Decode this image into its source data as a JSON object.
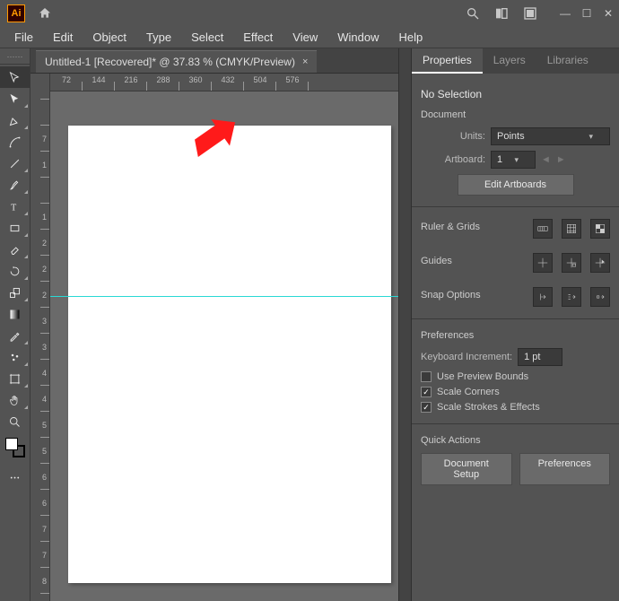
{
  "menu": {
    "file": "File",
    "edit": "Edit",
    "object": "Object",
    "type": "Type",
    "select": "Select",
    "effect": "Effect",
    "view": "View",
    "window": "Window",
    "help": "Help"
  },
  "document_tab": {
    "label": "Untitled-1 [Recovered]* @ 37.83 % (CMYK/Preview)",
    "close": "×"
  },
  "hruler_ticks": [
    "72",
    "144",
    "216",
    "288",
    "360",
    "432",
    "504",
    "576"
  ],
  "vruler_ticks": [
    "",
    "",
    "7",
    "1",
    "",
    "1",
    "2",
    "2",
    "2",
    "3",
    "3",
    "4",
    "4",
    "5",
    "5",
    "6",
    "6",
    "7",
    "7",
    "8"
  ],
  "panel": {
    "tabs": {
      "properties": "Properties",
      "layers": "Layers",
      "libraries": "Libraries"
    },
    "no_selection": "No Selection",
    "document": "Document",
    "units_label": "Units:",
    "units_value": "Points",
    "artboard_label": "Artboard:",
    "artboard_value": "1",
    "edit_artboards": "Edit Artboards",
    "ruler_grids": "Ruler & Grids",
    "guides": "Guides",
    "snap_options": "Snap Options",
    "preferences": "Preferences",
    "keyboard_increment_label": "Keyboard Increment:",
    "keyboard_increment_value": "1 pt",
    "use_preview_bounds": "Use Preview Bounds",
    "scale_corners": "Scale Corners",
    "scale_strokes": "Scale Strokes & Effects",
    "quick_actions": "Quick Actions",
    "document_setup": "Document Setup",
    "preferences_btn": "Preferences"
  }
}
